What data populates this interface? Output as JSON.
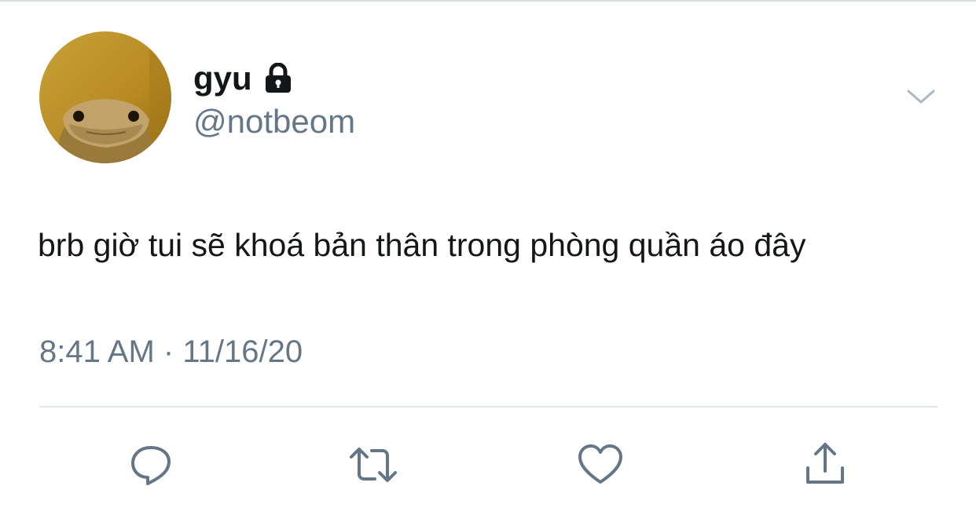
{
  "tweet": {
    "display_name": "gyu",
    "handle": "@notbeom",
    "text": "brb giờ tui sẽ khoá bản thân trong phòng quần áo đây",
    "time": "8:41 AM",
    "separator": "·",
    "date": "11/16/20",
    "is_protected": true
  },
  "icons": {
    "lock": "lock-icon",
    "menu": "chevron-down-icon",
    "reply": "reply-icon",
    "retweet": "retweet-icon",
    "like": "heart-icon",
    "share": "share-icon"
  },
  "colors": {
    "text_primary": "#14171a",
    "text_secondary": "#657786",
    "icon_gray": "#657786",
    "divider": "#e1e8ed"
  }
}
